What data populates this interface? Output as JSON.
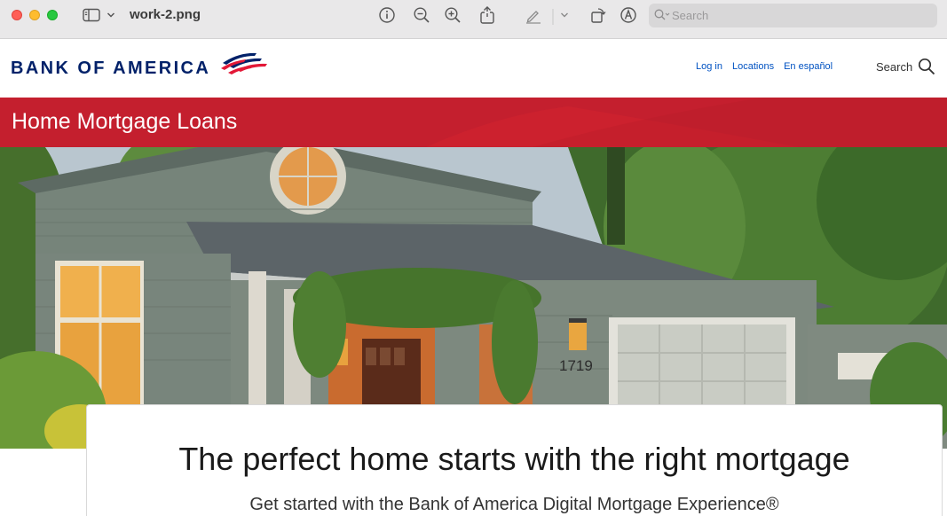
{
  "window": {
    "title": "work-2.png",
    "search_placeholder": "Search",
    "toolbar_icons": [
      "sidebar-icon",
      "chevron-down-icon",
      "info-icon",
      "zoom-out-icon",
      "zoom-in-icon",
      "share-icon",
      "markup-pen-icon",
      "chevron-down-icon",
      "rotate-icon",
      "annotate-icon"
    ]
  },
  "site": {
    "brand": "BANK OF AMERICA",
    "utility_links": [
      "Log in",
      "Locations",
      "En español"
    ],
    "search_label": "Search",
    "banner_title": "Home Mortgage Loans",
    "hero": {
      "house_number": "1719"
    },
    "card": {
      "headline": "The perfect home starts with the right mortgage",
      "subhead": "Get started with the Bank of America Digital Mortgage Experience®"
    }
  },
  "colors": {
    "brand_navy": "#012169",
    "brand_red": "#c41f2e",
    "link_blue": "#0052c2"
  }
}
